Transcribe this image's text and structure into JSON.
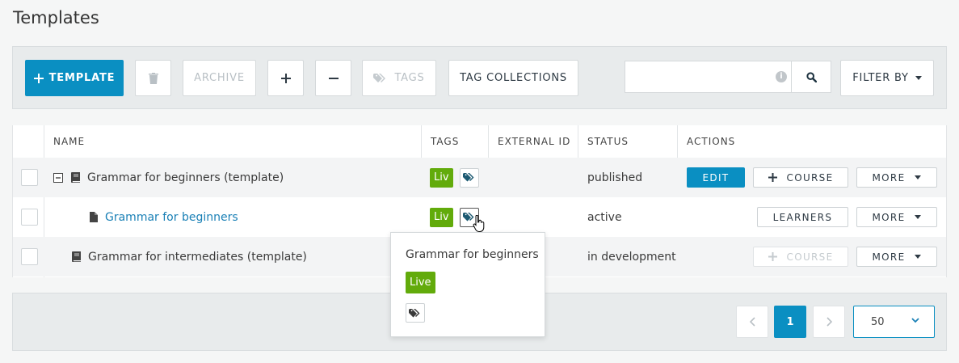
{
  "page": {
    "title": "Templates"
  },
  "toolbar": {
    "add_template_label": "TEMPLATE",
    "archive_label": "ARCHIVE",
    "tags_label": "TAGS",
    "tag_collections_label": "TAG COLLECTIONS",
    "filter_by_label": "FILTER BY",
    "search_placeholder": "",
    "search_info_glyph": "i"
  },
  "table": {
    "headers": {
      "name": "NAME",
      "tags": "TAGS",
      "external_id": "EXTERNAL ID",
      "status": "STATUS",
      "actions": "ACTIONS"
    },
    "rows": [
      {
        "name": "Grammar for beginners (template)",
        "tag": "Liv",
        "external_id": "",
        "status": "published",
        "actions": {
          "primary": "EDIT",
          "secondary": "COURSE",
          "more": "MORE"
        }
      },
      {
        "name": "Grammar for beginners",
        "tag": "Liv",
        "external_id": "",
        "status": "active",
        "actions": {
          "secondary": "LEARNERS",
          "more": "MORE"
        }
      },
      {
        "name": "Grammar for intermediates (template)",
        "external_id": "",
        "status": "in development",
        "actions": {
          "secondary": "COURSE",
          "more": "MORE"
        }
      }
    ]
  },
  "popover": {
    "title": "Grammar for beginners",
    "tag": "Live"
  },
  "pagination": {
    "current_page": "1",
    "per_page": "50"
  },
  "colors": {
    "primary": "#0a8fc2",
    "live_tag": "#62ab0b",
    "link": "#1a80b6",
    "tag_icon": "#1d5a72"
  }
}
